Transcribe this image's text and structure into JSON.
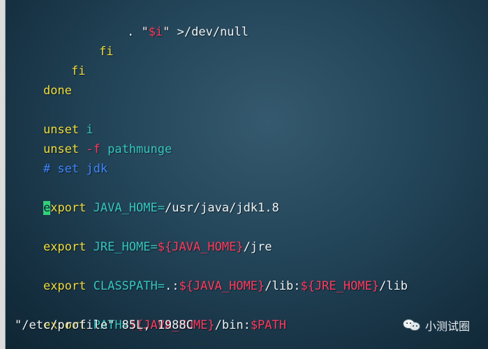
{
  "editor": {
    "lines": [
      [
        {
          "t": ". ",
          "c": "plain"
        },
        {
          "t": "\"",
          "c": "str"
        },
        {
          "t": "$i",
          "c": "var"
        },
        {
          "t": "\" ",
          "c": "str"
        },
        {
          "t": ">/dev/null",
          "c": "plain"
        }
      ],
      [
        {
          "t": "fi",
          "c": "kw"
        }
      ],
      [
        {
          "t": "fi",
          "c": "kw"
        }
      ],
      [
        {
          "t": "done",
          "c": "kw"
        }
      ],
      [],
      [
        {
          "t": "unset ",
          "c": "kw"
        },
        {
          "t": "i",
          "c": "ident"
        }
      ],
      [
        {
          "t": "unset ",
          "c": "kw"
        },
        {
          "t": "-f ",
          "c": "var"
        },
        {
          "t": "pathmunge",
          "c": "ident"
        }
      ],
      [
        {
          "t": "# set jdk",
          "c": "comment"
        }
      ],
      [],
      [
        {
          "t": "e",
          "c": "cursor"
        },
        {
          "t": "xport ",
          "c": "kw"
        },
        {
          "t": "JAVA_HOME=",
          "c": "ident"
        },
        {
          "t": "/usr/java/jdk1.8",
          "c": "plain"
        }
      ],
      [],
      [
        {
          "t": "export ",
          "c": "kw"
        },
        {
          "t": "JRE_HOME=",
          "c": "ident"
        },
        {
          "t": "${JAVA_HOME}",
          "c": "var"
        },
        {
          "t": "/jre",
          "c": "plain"
        }
      ],
      [],
      [
        {
          "t": "export ",
          "c": "kw"
        },
        {
          "t": "CLASSPATH=",
          "c": "ident"
        },
        {
          "t": ".:",
          "c": "plain"
        },
        {
          "t": "${JAVA_HOME}",
          "c": "var"
        },
        {
          "t": "/lib:",
          "c": "plain"
        },
        {
          "t": "${JRE_HOME}",
          "c": "var"
        },
        {
          "t": "/lib",
          "c": "plain"
        }
      ],
      [],
      [
        {
          "t": "export ",
          "c": "kw"
        },
        {
          "t": "PATH=",
          "c": "ident"
        },
        {
          "t": "${JAVA_HOME}",
          "c": "var"
        },
        {
          "t": "/bin:",
          "c": "plain"
        },
        {
          "t": "$PATH",
          "c": "var"
        }
      ]
    ],
    "status_line": "\"/etc/profile\" 85L, 1988C"
  },
  "watermark": {
    "text": "小测试圈",
    "icon": "wechat-icon"
  },
  "colors": {
    "keyword": "#f0dc3c",
    "variable": "#ff3a5e",
    "identifier": "#36c7c0",
    "comment": "#3f86ff",
    "cursor": "#34d07a"
  }
}
